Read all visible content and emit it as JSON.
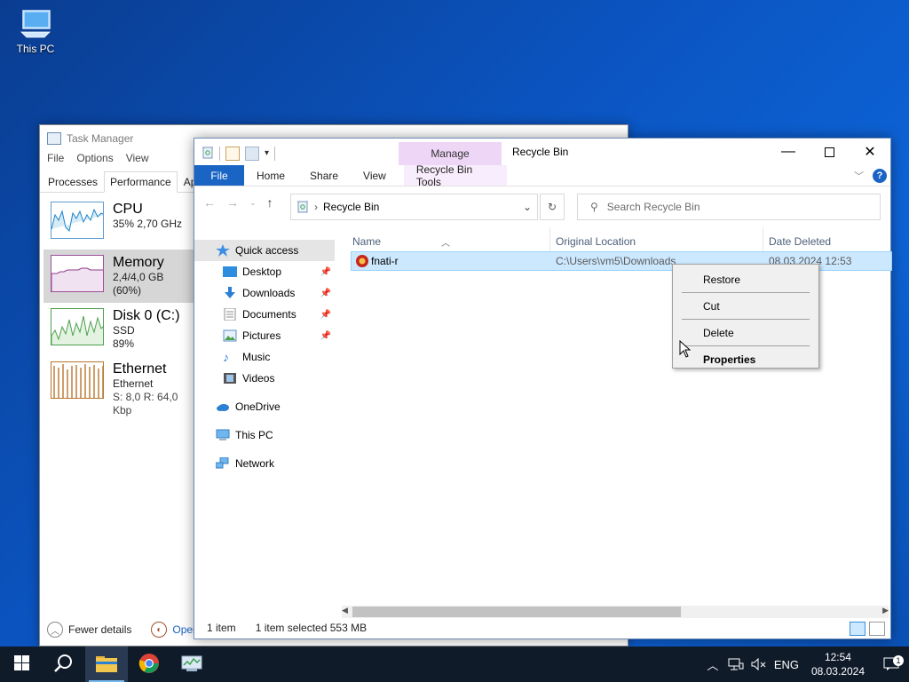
{
  "desktop": {
    "this_pc_label": "This PC"
  },
  "task_manager": {
    "title": "Task Manager",
    "menu": [
      "File",
      "Options",
      "View"
    ],
    "tabs": [
      "Processes",
      "Performance",
      "App"
    ],
    "perf_items": [
      {
        "name": "CPU",
        "sub1": "35%  2,70 GHz",
        "sub2": ""
      },
      {
        "name": "Memory",
        "sub1": "2,4/4,0 GB (60%)",
        "sub2": ""
      },
      {
        "name": "Disk 0 (C:)",
        "sub1": "SSD",
        "sub2": "89%"
      },
      {
        "name": "Ethernet",
        "sub1": "Ethernet",
        "sub2": "S: 8,0  R: 64,0 Kbp"
      }
    ],
    "fewer_details": "Fewer details",
    "open_resource": "Open I"
  },
  "explorer": {
    "manage_tab": "Manage",
    "window_title": "Recycle Bin",
    "ribbon": {
      "file": "File",
      "home": "Home",
      "share": "Share",
      "view": "View",
      "tools": "Recycle Bin Tools"
    },
    "address": "Recycle Bin",
    "search_placeholder": "Search Recycle Bin",
    "nav": {
      "quick_access": "Quick access",
      "desktop": "Desktop",
      "downloads": "Downloads",
      "documents": "Documents",
      "pictures": "Pictures",
      "music": "Music",
      "videos": "Videos",
      "onedrive": "OneDrive",
      "this_pc": "This PC",
      "network": "Network"
    },
    "columns": {
      "name": "Name",
      "original_location": "Original Location",
      "date_deleted": "Date Deleted"
    },
    "row": {
      "name": "fnati-r",
      "location": "C:\\Users\\vm5\\Downloads",
      "date": "08.03.2024 12:53"
    },
    "status": {
      "count": "1 item",
      "selected": "1 item selected  553 MB"
    }
  },
  "context_menu": {
    "restore": "Restore",
    "cut": "Cut",
    "delete": "Delete",
    "properties": "Properties"
  },
  "taskbar": {
    "language": "ENG",
    "time": "12:54",
    "date": "08.03.2024",
    "notifications": "1"
  }
}
